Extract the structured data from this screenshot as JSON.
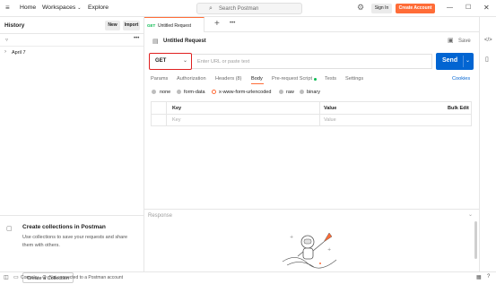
{
  "topbar": {
    "nav": [
      "Home",
      "Workspaces",
      "Explore"
    ],
    "search_placeholder": "Search Postman",
    "sign_in": "Sign In",
    "create_account": "Create Account"
  },
  "sidebar": {
    "title": "History",
    "new_label": "New",
    "import_label": "Import",
    "group_label": "April 7",
    "promo_title": "Create collections in Postman",
    "promo_text": "Use collections to save your requests and share them with others.",
    "promo_button": "Create a Collection"
  },
  "tabs": {
    "active_tab_method": "GET",
    "active_tab_title": "Untitled Request"
  },
  "request": {
    "title": "Untitled Request",
    "save_label": "Save",
    "method": "GET",
    "url_placeholder": "Enter URL or paste text",
    "send_label": "Send",
    "subtabs": [
      "Params",
      "Authorization",
      "Headers (8)",
      "Body",
      "Pre-request Script",
      "Tests",
      "Settings"
    ],
    "active_subtab": "Body",
    "cookies_label": "Cookies",
    "body_options": [
      "none",
      "form-data",
      "x-www-form-urlencoded",
      "raw",
      "binary"
    ],
    "selected_body_option": "x-www-form-urlencoded",
    "table": {
      "headers": [
        "Key",
        "Value",
        "Bulk Edit"
      ],
      "placeholder_row": [
        "Key",
        "Value"
      ]
    }
  },
  "response": {
    "label": "Response"
  },
  "footer": {
    "console": "Console",
    "status": "Not connected to a Postman account"
  },
  "colors": {
    "accent": "#ff6c37",
    "send_blue": "#0265d2",
    "highlight_red": "#e02020",
    "green_dot": "#0cbb52"
  }
}
